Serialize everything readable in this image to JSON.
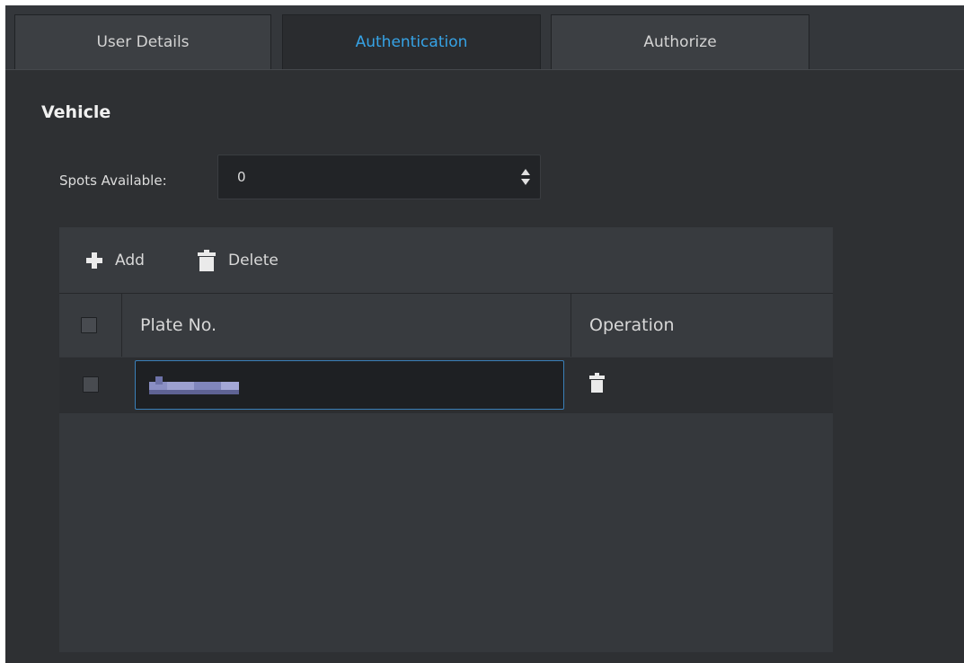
{
  "tabs": [
    {
      "label": "User Details",
      "active": false
    },
    {
      "label": "Authentication",
      "active": true
    },
    {
      "label": "Authorize",
      "active": false
    }
  ],
  "section": {
    "title": "Vehicle"
  },
  "spots": {
    "label": "Spots Available:",
    "value": "0"
  },
  "toolbar": {
    "add_label": "Add",
    "delete_label": "Delete"
  },
  "table": {
    "columns": [
      "Plate No.",
      "Operation"
    ],
    "rows": [
      {
        "plate_no": "",
        "plate_obscured": true,
        "selected": false
      }
    ]
  },
  "colors": {
    "panel_bg": "#2e3033",
    "active_tab_text": "#36a3e6",
    "input_focus_border": "#3a7fb8"
  }
}
